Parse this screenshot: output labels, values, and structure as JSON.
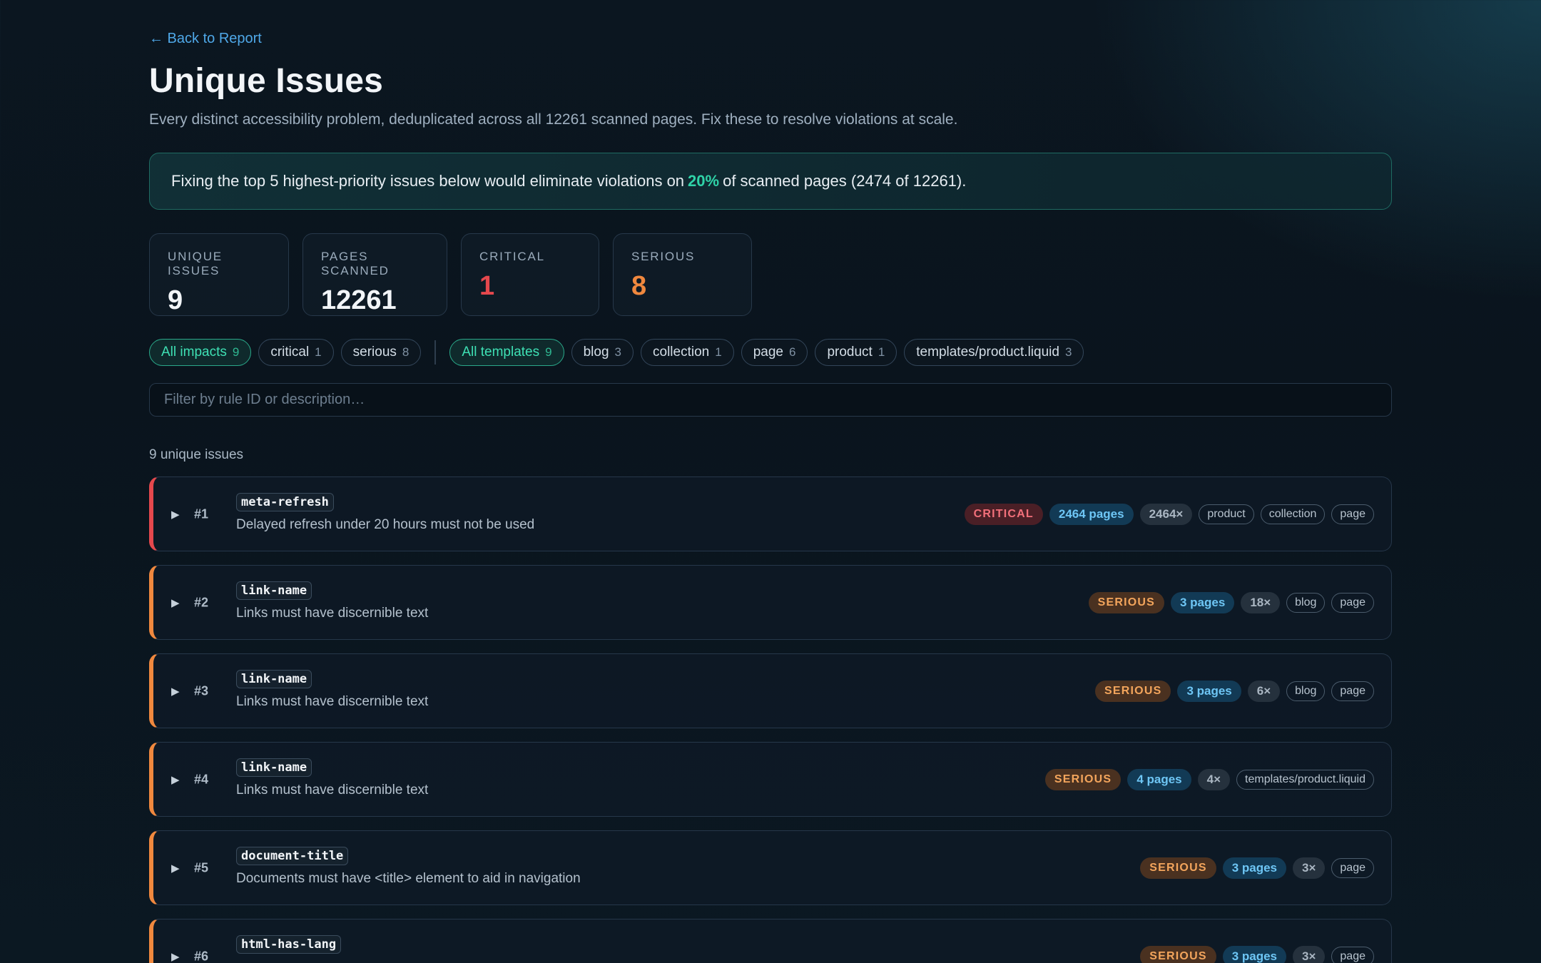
{
  "nav": {
    "back_label": "← Back to Report"
  },
  "header": {
    "title": "Unique Issues",
    "subtitle": "Every distinct accessibility problem, deduplicated across all 12261 scanned pages. Fix these to resolve violations at scale."
  },
  "banner": {
    "text_before": "Fixing the top 5 highest-priority issues below would eliminate violations on",
    "percent": "20%",
    "text_after": "of scanned pages (2474 of 12261)."
  },
  "stats": [
    {
      "label": "UNIQUE ISSUES",
      "value": "9"
    },
    {
      "label": "PAGES SCANNED",
      "value": "12261"
    },
    {
      "label": "CRITICAL",
      "value": "1"
    },
    {
      "label": "SERIOUS",
      "value": "8"
    }
  ],
  "colors": {
    "critical": "#e5484d",
    "serious": "#f0883e",
    "accent": "#2fd3a8",
    "link": "#4fa8e8"
  },
  "impact_filters": [
    {
      "label": "All impacts",
      "count": "9",
      "active": true
    },
    {
      "label": "critical",
      "count": "1",
      "active": false
    },
    {
      "label": "serious",
      "count": "8",
      "active": false
    }
  ],
  "template_filters": [
    {
      "label": "All templates",
      "count": "9",
      "active": true
    },
    {
      "label": "blog",
      "count": "3",
      "active": false
    },
    {
      "label": "collection",
      "count": "1",
      "active": false
    },
    {
      "label": "page",
      "count": "6",
      "active": false
    },
    {
      "label": "product",
      "count": "1",
      "active": false
    },
    {
      "label": "templates/product.liquid",
      "count": "3",
      "active": false
    }
  ],
  "search": {
    "placeholder": "Filter by rule ID or description…",
    "value": ""
  },
  "results_count": "9 unique issues",
  "issues": [
    {
      "rank": "#1",
      "rule": "meta-refresh",
      "description": "Delayed refresh under 20 hours must not be used",
      "impact": "CRITICAL",
      "pages": "2464 pages",
      "occurrences": "2464×",
      "templates": [
        "product",
        "collection",
        "page"
      ]
    },
    {
      "rank": "#2",
      "rule": "link-name",
      "description": "Links must have discernible text",
      "impact": "SERIOUS",
      "pages": "3 pages",
      "occurrences": "18×",
      "templates": [
        "blog",
        "page"
      ]
    },
    {
      "rank": "#3",
      "rule": "link-name",
      "description": "Links must have discernible text",
      "impact": "SERIOUS",
      "pages": "3 pages",
      "occurrences": "6×",
      "templates": [
        "blog",
        "page"
      ]
    },
    {
      "rank": "#4",
      "rule": "link-name",
      "description": "Links must have discernible text",
      "impact": "SERIOUS",
      "pages": "4 pages",
      "occurrences": "4×",
      "templates": [
        "templates/product.liquid"
      ]
    },
    {
      "rank": "#5",
      "rule": "document-title",
      "description": "Documents must have <title> element to aid in navigation",
      "impact": "SERIOUS",
      "pages": "3 pages",
      "occurrences": "3×",
      "templates": [
        "page"
      ]
    },
    {
      "rank": "#6",
      "rule": "html-has-lang",
      "description": "",
      "impact": "SERIOUS",
      "pages": "3 pages",
      "occurrences": "3×",
      "templates": [
        "page"
      ]
    }
  ]
}
